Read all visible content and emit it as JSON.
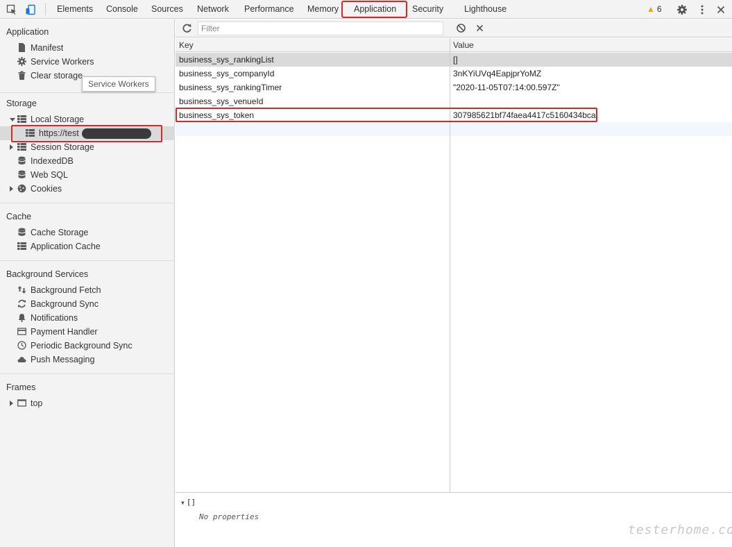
{
  "toolbar": {
    "tabs": [
      "Elements",
      "Console",
      "Sources",
      "Network",
      "Performance",
      "Memory",
      "Application",
      "Security",
      "Lighthouse"
    ],
    "active_tab": "Application",
    "warning_count": "6",
    "icons": [
      "inspect-icon",
      "device-toggle-icon",
      "warning-icon",
      "gear-icon",
      "more-vert-icon",
      "close-icon"
    ]
  },
  "sidebar": {
    "tooltip": "Service Workers",
    "sections": {
      "application": {
        "title": "Application",
        "items": [
          "Manifest",
          "Service Workers",
          "Clear storage"
        ]
      },
      "storage": {
        "title": "Storage",
        "items": [
          "Local Storage",
          "https://test",
          "Session Storage",
          "IndexedDB",
          "Web SQL",
          "Cookies"
        ]
      },
      "cache": {
        "title": "Cache",
        "items": [
          "Cache Storage",
          "Application Cache"
        ]
      },
      "background": {
        "title": "Background Services",
        "items": [
          "Background Fetch",
          "Background Sync",
          "Notifications",
          "Payment Handler",
          "Periodic Background Sync",
          "Push Messaging"
        ]
      },
      "frames": {
        "title": "Frames",
        "items": [
          "top"
        ]
      }
    }
  },
  "main": {
    "filter_placeholder": "Filter",
    "columns": {
      "key": "Key",
      "value": "Value"
    },
    "rows": [
      {
        "key": "business_sys_rankingList",
        "value": "[]"
      },
      {
        "key": "business_sys_companyId",
        "value": "3nKYiUVq4EapjprYoMZ"
      },
      {
        "key": "business_sys_rankingTimer",
        "value": "\"2020-11-05T07:14:00.597Z\""
      },
      {
        "key": "business_sys_venueId",
        "value": ""
      },
      {
        "key": "business_sys_token",
        "value": "307985621bf74faea4417c5160434bca"
      }
    ],
    "preview": {
      "root": "[]",
      "empty": "No properties"
    }
  },
  "watermark": "testerhome.com",
  "colors": {
    "highlight_red": "#e02424",
    "selection": "#dadada",
    "warning": "#e6a800"
  }
}
